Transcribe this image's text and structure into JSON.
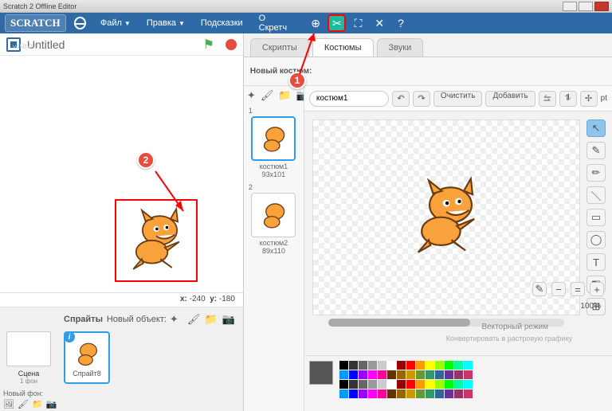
{
  "titlebar": {
    "text": "Scratch 2 Offline Editor"
  },
  "menu": {
    "file": "Файл",
    "edit": "Правка",
    "tips": "Подсказки",
    "about": "О Скретч"
  },
  "annotations": {
    "n1": "1",
    "n2": "2"
  },
  "project": {
    "title": "Untitled",
    "version": "v458.0.1"
  },
  "coords": {
    "x_label": "x:",
    "x": "-240",
    "y_label": "y:",
    "y": "-180"
  },
  "sprites": {
    "panel": "Спрайты",
    "new_label": "Новый объект:",
    "stage_label": "Сцена",
    "stage_sub": "1 фон",
    "new_bg": "Новый фон:",
    "sprite1": "Спрайт8"
  },
  "tabs": {
    "scripts": "Скрипты",
    "costumes": "Костюмы",
    "sounds": "Звуки"
  },
  "costumes": {
    "new_label": "Новый костюм:",
    "c1_name": "костюм1",
    "c1_size": "93x101",
    "n1": "1",
    "c2_name": "костюм2",
    "c2_size": "89x110",
    "n2": "2"
  },
  "editor": {
    "name": "костюм1",
    "clear": "Очистить",
    "add": "Добавить",
    "pt": "pt",
    "zoom": "100%",
    "vector_mode": "Векторный режим",
    "vector_sub": "Конвертировать в растровую графику"
  }
}
